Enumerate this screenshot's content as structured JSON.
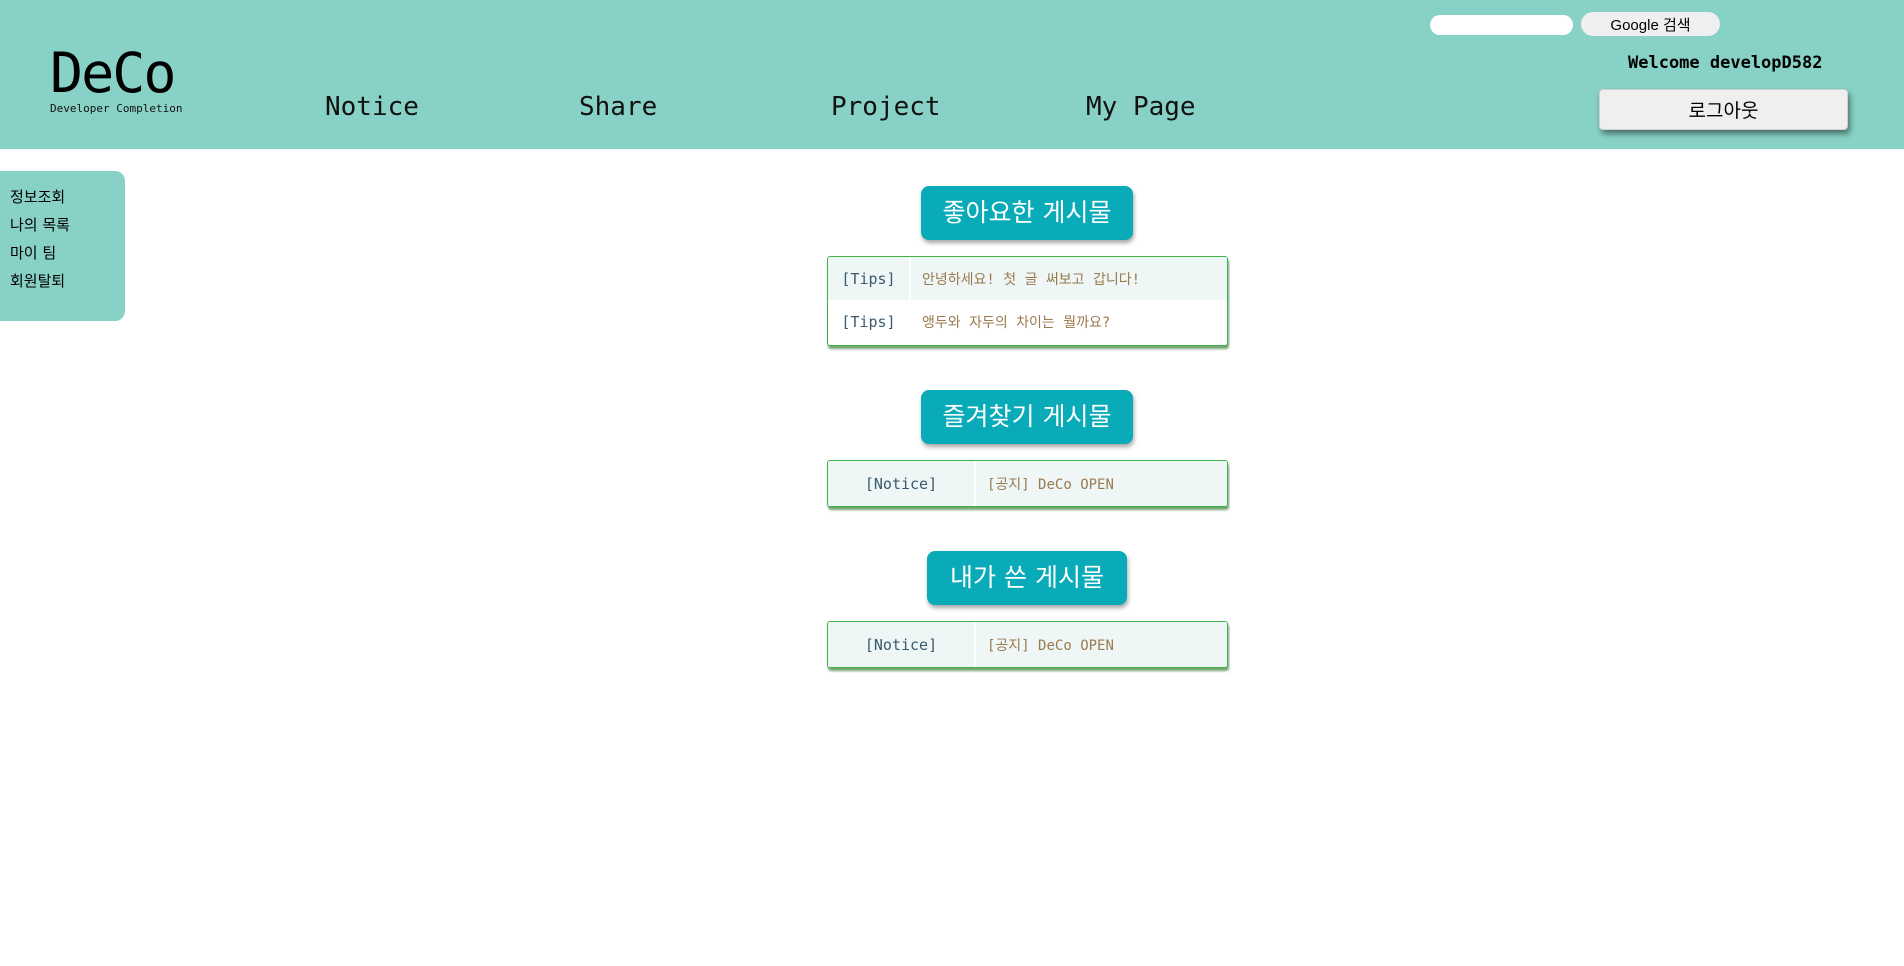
{
  "header": {
    "logo": {
      "title": "DeCo",
      "subtitle": "Developer Completion"
    },
    "nav": [
      {
        "label": "Notice"
      },
      {
        "label": "Share"
      },
      {
        "label": "Project"
      },
      {
        "label": "My Page"
      }
    ],
    "search": {
      "value": "",
      "button_label": "Google 검색"
    },
    "welcome_text": "Welcome developD582",
    "logout_label": "로그아웃"
  },
  "sidebar": {
    "items": [
      {
        "label": "정보조회"
      },
      {
        "label": "나의 목록"
      },
      {
        "label": "마이 팀"
      },
      {
        "label": "회원탈퇴"
      }
    ]
  },
  "sections": {
    "liked": {
      "title": "좋아요한 게시물",
      "posts": [
        {
          "category": "[Tips]",
          "title": "안녕하세요! 첫 글 써보고 갑니다!"
        },
        {
          "category": "[Tips]",
          "title": "앵두와 자두의 차이는 뭘까요?"
        }
      ]
    },
    "bookmarked": {
      "title": "즐겨찾기 게시물",
      "posts": [
        {
          "category": "[Notice]",
          "title": "[공지] DeCo OPEN"
        }
      ]
    },
    "mine": {
      "title": "내가 쓴 게시물",
      "posts": [
        {
          "category": "[Notice]",
          "title": "[공지] DeCo OPEN"
        }
      ]
    }
  },
  "colors": {
    "header_bg": "#88d1c6",
    "section_title_bg": "#0aabb9",
    "table_border": "#3fb24a",
    "row_shade": "#eef6f6",
    "post_title_text": "#9a7a4e"
  }
}
